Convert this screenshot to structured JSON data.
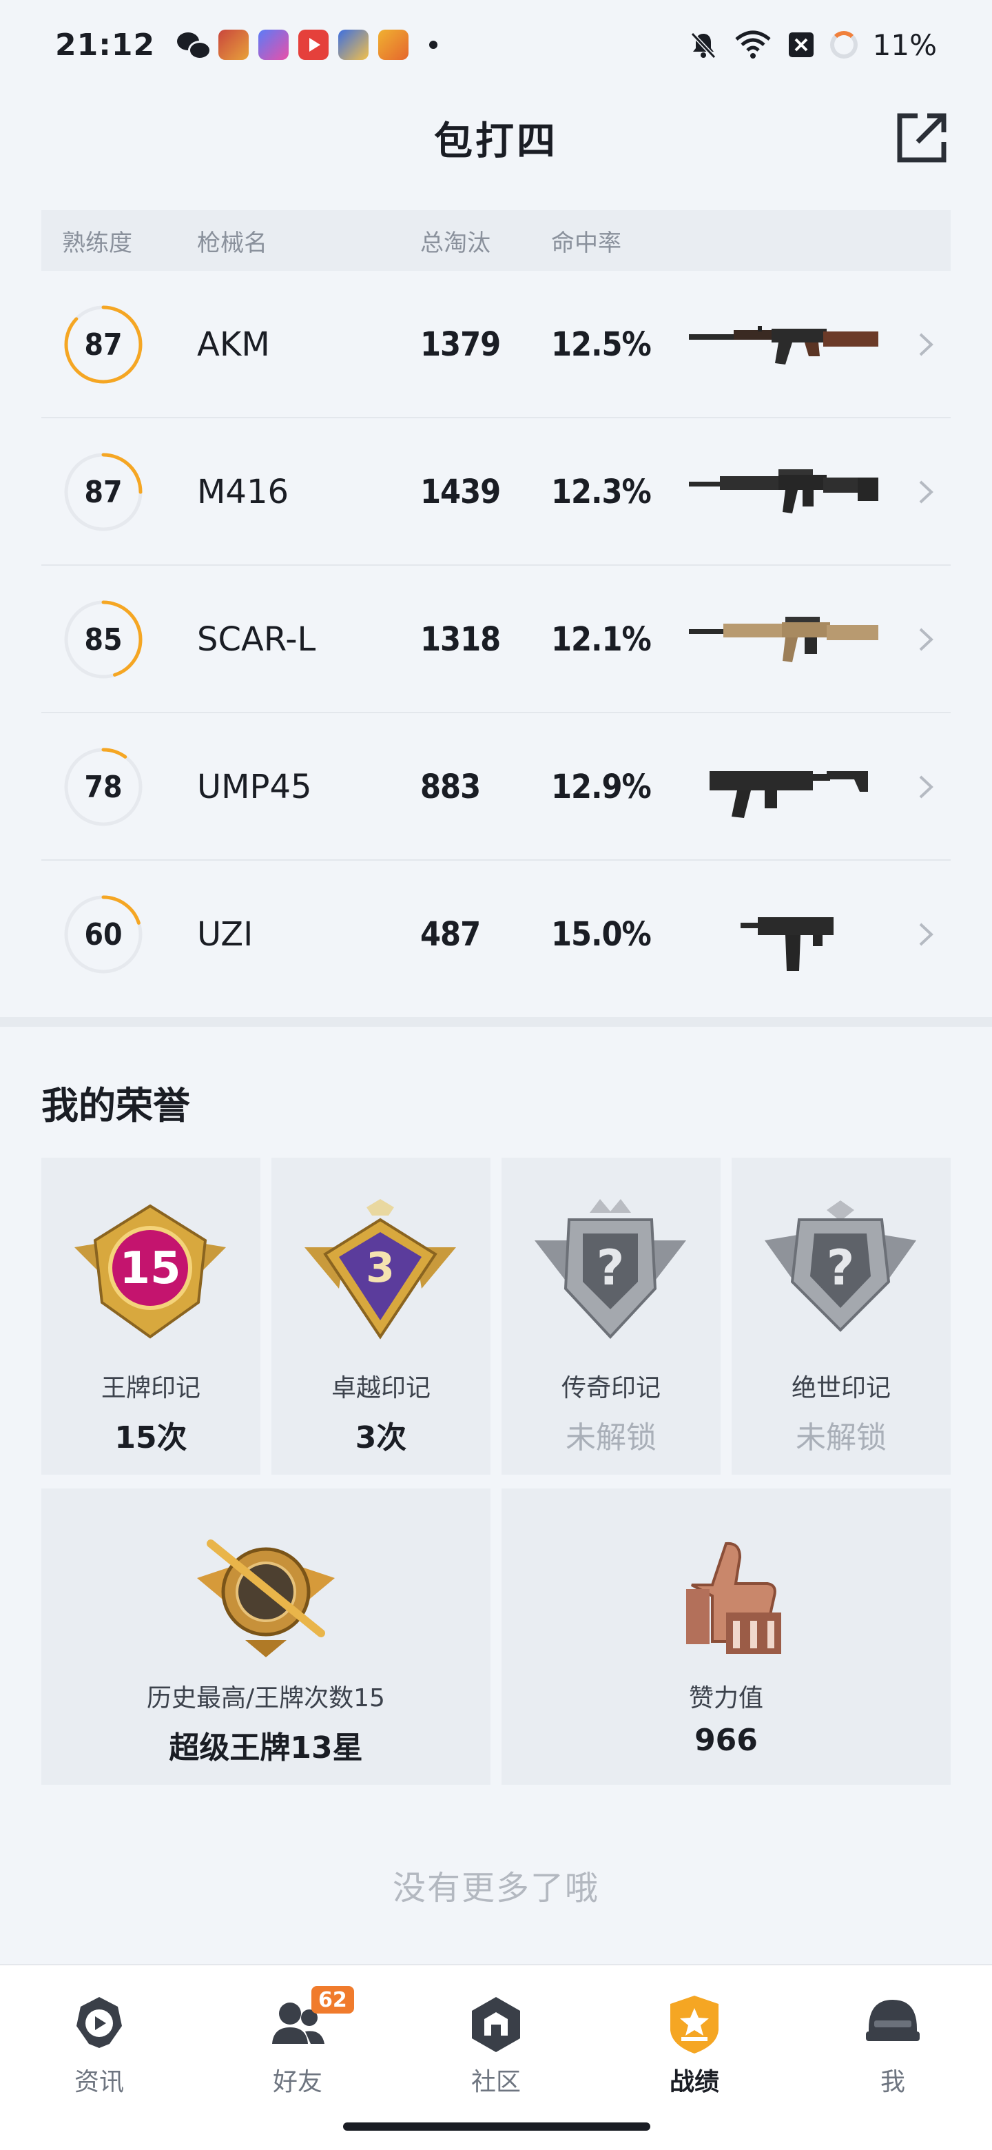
{
  "status_bar": {
    "time": "21:12",
    "battery_percent": "11%",
    "icons": [
      "wechat-icon",
      "game-app-icon",
      "app-icon",
      "video-app-icon",
      "game-app-icon",
      "game-app-icon",
      "dot-icon",
      "mute-icon",
      "wifi-icon",
      "sim-icon",
      "battery-ring-icon"
    ]
  },
  "header": {
    "title": "包打四",
    "share_icon": "share-external-icon"
  },
  "weapon_table": {
    "columns": {
      "mastery": "熟练度",
      "name": "枪械名",
      "kills": "总淘汰",
      "accuracy": "命中率"
    },
    "rows": [
      {
        "mastery": "87",
        "mastery_level": 0.87,
        "name": "AKM",
        "kills": "1379",
        "accuracy": "12.5%",
        "weapon_icon": "akm-rifle-icon"
      },
      {
        "mastery": "87",
        "mastery_level": 0.25,
        "name": "M416",
        "kills": "1439",
        "accuracy": "12.3%",
        "weapon_icon": "m416-rifle-icon"
      },
      {
        "mastery": "85",
        "mastery_level": 0.45,
        "name": "SCAR-L",
        "kills": "1318",
        "accuracy": "12.1%",
        "weapon_icon": "scar-l-rifle-icon"
      },
      {
        "mastery": "78",
        "mastery_level": 0.1,
        "name": "UMP45",
        "kills": "883",
        "accuracy": "12.9%",
        "weapon_icon": "ump45-smg-icon"
      },
      {
        "mastery": "60",
        "mastery_level": 0.2,
        "name": "UZI",
        "kills": "487",
        "accuracy": "15.0%",
        "weapon_icon": "uzi-smg-icon"
      }
    ]
  },
  "honors": {
    "title": "我的荣誉",
    "badges": [
      {
        "label": "王牌印记",
        "value": "15次",
        "number": "15",
        "locked": false,
        "icon": "ace-emblem-icon"
      },
      {
        "label": "卓越印记",
        "value": "3次",
        "number": "3",
        "locked": false,
        "icon": "excellence-emblem-icon"
      },
      {
        "label": "传奇印记",
        "value": "未解锁",
        "number": "?",
        "locked": true,
        "icon": "legend-emblem-locked-icon"
      },
      {
        "label": "绝世印记",
        "value": "未解锁",
        "number": "?",
        "locked": true,
        "icon": "peerless-emblem-locked-icon"
      }
    ],
    "stats": [
      {
        "label": "历史最高/王牌次数15",
        "value": "超级王牌13星",
        "icon": "super-ace-emblem-icon"
      },
      {
        "label": "赞力值",
        "value": "966",
        "icon": "thumbs-up-trophy-icon"
      }
    ]
  },
  "footer_note": "没有更多了哦",
  "bottom_nav": {
    "items": [
      {
        "label": "资讯",
        "icon": "news-icon",
        "active": false
      },
      {
        "label": "好友",
        "icon": "friends-icon",
        "active": false,
        "badge": "62"
      },
      {
        "label": "社区",
        "icon": "community-icon",
        "active": false
      },
      {
        "label": "战绩",
        "icon": "record-badge-icon",
        "active": true
      },
      {
        "label": "我",
        "icon": "helmet-icon",
        "active": false
      }
    ]
  },
  "colors": {
    "accent_orange": "#f5a623",
    "ring_track": "#e6e9ee",
    "badge_orange": "#f07b2c",
    "background": "#f2f5f9"
  }
}
